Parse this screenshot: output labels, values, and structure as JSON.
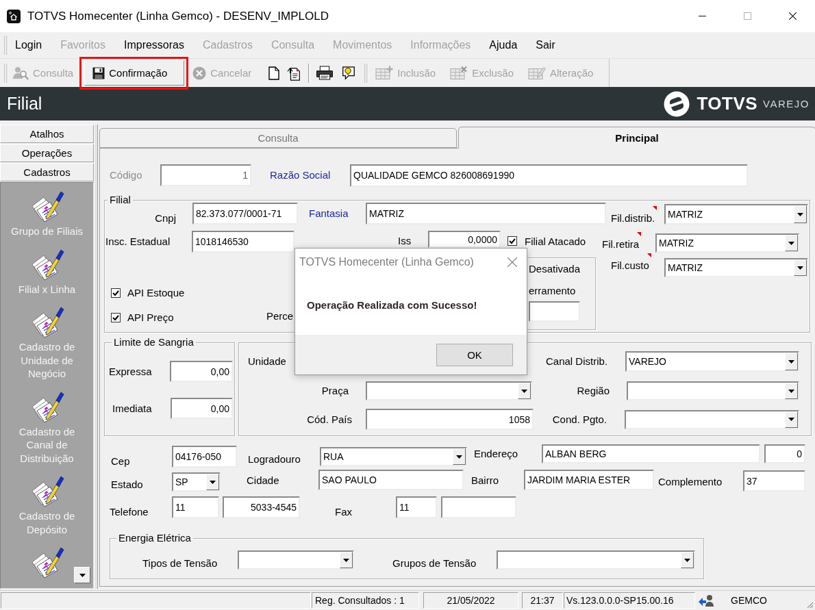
{
  "window": {
    "title": "TOTVS Homecenter (Linha Gemco) - DESENV_IMPLOLD"
  },
  "menu": [
    {
      "label": "Login",
      "disabled": false
    },
    {
      "label": "Favoritos",
      "disabled": true
    },
    {
      "label": "Impressoras",
      "disabled": false
    },
    {
      "label": "Cadastros",
      "disabled": true
    },
    {
      "label": "Consulta",
      "disabled": true
    },
    {
      "label": "Movimentos",
      "disabled": true
    },
    {
      "label": "Informações",
      "disabled": true
    },
    {
      "label": "Ajuda",
      "disabled": false
    },
    {
      "label": "Sair",
      "disabled": false
    }
  ],
  "toolbar": {
    "left": [
      {
        "label": "Consulta",
        "disabled": true,
        "highlighted": false
      },
      {
        "label": "Confirmação",
        "disabled": false,
        "highlighted": true
      },
      {
        "label": "Cancelar",
        "disabled": true,
        "highlighted": false
      }
    ],
    "right": [
      {
        "label": "Inclusão",
        "disabled": true
      },
      {
        "label": "Exclusão",
        "disabled": true
      },
      {
        "label": "Alteração",
        "disabled": true
      }
    ]
  },
  "header": {
    "title": "Filial",
    "logo": "TOTVS",
    "logo_sub": "VAREJO"
  },
  "sidebar": {
    "sections": [
      "Atalhos",
      "Operações",
      "Cadastros"
    ],
    "items": [
      "Grupo de Filiais",
      "Filial x Linha",
      "Cadastro de Unidade de Negócio",
      "Cadastro de Canal de Distribuição",
      "Cadastro de Depósito"
    ]
  },
  "tabs": [
    {
      "label": "Consulta",
      "selected": false
    },
    {
      "label": "Principal",
      "selected": true
    }
  ],
  "form": {
    "codigo": {
      "label": "Código",
      "value": "1",
      "disabled": true
    },
    "razao_social": {
      "label": "Razão Social",
      "value": "QUALIDADE GEMCO 826008691990",
      "link": true
    },
    "filial": {
      "title": "Filial",
      "cnpj": {
        "label": "Cnpj",
        "value": "82.373.077/0001-71"
      },
      "fantasia": {
        "label": "Fantasia",
        "value": "MATRIZ",
        "link": true
      },
      "fil_distrib": {
        "label": "Fil.distrib.",
        "value": "MATRIZ",
        "flagged": true
      },
      "insc_estadual": {
        "label": "Insc. Estadual",
        "value": "1018146530"
      },
      "iss": {
        "label": "Iss",
        "value": "0,0000"
      },
      "filial_atacado": {
        "label": "Filial Atacado",
        "checked": true
      },
      "fil_retira": {
        "label": "Fil.retira",
        "value": "MATRIZ",
        "flagged": true
      },
      "desativada": {
        "label": "Desativada"
      },
      "encerramento": {
        "label": "erramento"
      },
      "fil_custo": {
        "label": "Fil.custo",
        "value": "MATRIZ",
        "flagged": true
      },
      "api_estoque": {
        "label": "API Estoque",
        "checked": true
      },
      "api_preco": {
        "label": "API Preço",
        "checked": true
      },
      "percentual": {
        "label": "Perce"
      }
    },
    "limite_sangria": {
      "title": "Limite de Sangria",
      "expressa": {
        "label": "Expressa",
        "value": "0,00"
      },
      "imediata": {
        "label": "Imediata",
        "value": "0,00"
      }
    },
    "distribuicao": {
      "unidade": {
        "label": "Unidade"
      },
      "canal_distrib": {
        "label": "Canal Distrib.",
        "value": "VAREJO"
      },
      "praca": {
        "label": "Praça"
      },
      "regiao": {
        "label": "Região"
      },
      "cod_pais": {
        "label": "Cód. País",
        "value": "1058"
      },
      "cond_pgto": {
        "label": "Cond. Pgto."
      }
    },
    "endereco": {
      "cep": {
        "label": "Cep",
        "value": "04176-050"
      },
      "logradouro": {
        "label": "Logradouro",
        "value": "RUA"
      },
      "endereco": {
        "label": "Endereço",
        "value": "ALBAN BERG",
        "number": "0"
      },
      "estado": {
        "label": "Estado",
        "value": "SP"
      },
      "cidade": {
        "label": "Cidade",
        "value": "SAO PAULO"
      },
      "bairro": {
        "label": "Bairro",
        "value": "JARDIM MARIA ESTER"
      },
      "complemento": {
        "label": "Complemento",
        "value": "37"
      },
      "telefone": {
        "label": "Telefone",
        "area_code": "11",
        "number": "5033-4545"
      },
      "fax": {
        "label": "Fax",
        "area_code": "11"
      }
    },
    "energia": {
      "title": "Energia Elétrica",
      "tipos_tensao": {
        "label": "Tipos de Tensão"
      },
      "grupos_tensao": {
        "label": "Grupos de Tensão"
      }
    }
  },
  "dialog": {
    "title": "TOTVS Homecenter (Linha Gemco)",
    "message": "Operação Realizada com Sucesso!",
    "button": "OK"
  },
  "status_bar": {
    "records": "Reg. Consultados : 1",
    "date": "21/05/2022",
    "time": "21:37",
    "version": "Vs.123.0.0.0-SP15.00.16",
    "user": "GEMCO"
  }
}
